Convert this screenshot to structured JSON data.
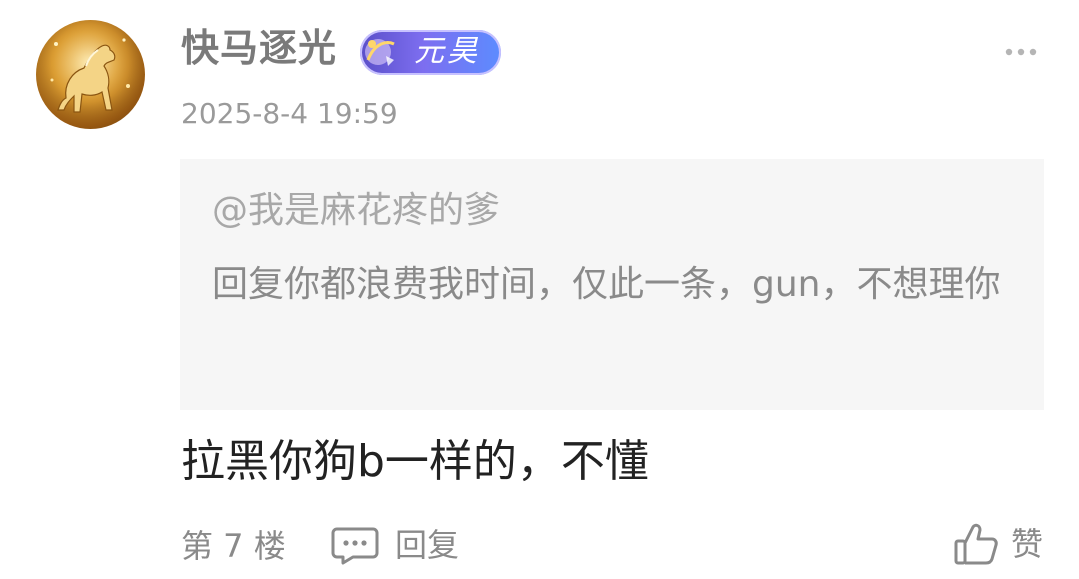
{
  "author": {
    "name": "快马逐光",
    "badge_text": "元昊",
    "avatar_icon": "golden-horse-avatar"
  },
  "post": {
    "timestamp": "2025-8-4 19:59",
    "content": "拉黑你狗b一样的，不懂",
    "floor": "第 7 楼"
  },
  "quote": {
    "mention": "@我是麻花疼的爹",
    "text": "回复你都浪费我时间，仅此一条，gun，不想理你"
  },
  "actions": {
    "reply_label": "回复",
    "like_label": "赞",
    "more_icon": "more-dots-icon",
    "reply_icon": "comment-bubble-icon",
    "like_icon": "thumbs-up-icon"
  },
  "colors": {
    "username": "#7a7a7a",
    "meta": "#9a9a9a",
    "quote_bg": "#f6f6f6",
    "badge_from": "#5a4fc8",
    "badge_to": "#5c8cff"
  }
}
